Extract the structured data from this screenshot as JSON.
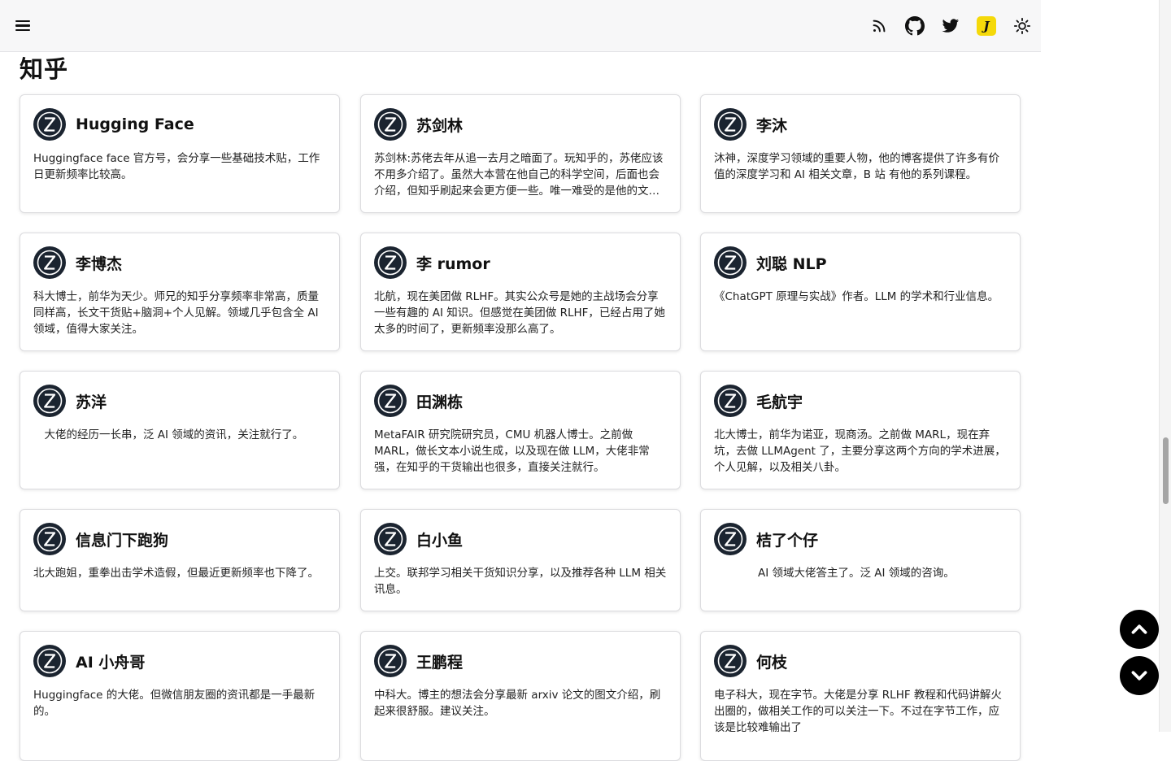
{
  "header": {
    "menu_icon": "hamburger-menu-icon",
    "icons": [
      "rss-icon",
      "github-icon",
      "twitter-icon",
      "j-badge-icon",
      "sun-icon"
    ],
    "j_badge_text": "J"
  },
  "section": {
    "title": "知乎"
  },
  "cards": [
    {
      "name": "Hugging Face",
      "desc": "Huggingface face 官方号，会分享一些基础技术贴，工作日更新频率比较高。"
    },
    {
      "name": "苏剑林",
      "desc": "苏剑林:苏佬去年从追一去月之暗面了。玩知乎的，苏佬应该不用多介绍了。虽然大本营在他自己的科学空间，后面也会介绍，但知乎刷起来会更方便一些。唯一难受的是他的文章公式太多了，知乎上看可能会比较吃力。"
    },
    {
      "name": "李沐",
      "desc": "沐神，深度学习领域的重要人物，他的博客提供了许多有价值的深度学习和 AI 相关文章，B 站 有他的系列课程。"
    },
    {
      "name": "李博杰",
      "desc": "科大博士，前华为天少。师兄的知乎分享频率非常高，质量同样高，长文干货贴+脑洞+个人见解。领域几乎包含全 AI 领域，值得大家关注。"
    },
    {
      "name": "李 rumor",
      "desc": "北航，现在美团做 RLHF。其实公众号是她的主战场会分享一些有趣的 AI 知识。但感觉在美团做 RLHF，已经占用了她太多的时间了，更新频率没那么高了。"
    },
    {
      "name": "刘聪 NLP",
      "desc": "《ChatGPT 原理与实战》作者。LLM 的学术和行业信息。"
    },
    {
      "name": "苏洋",
      "desc": "　大佬的经历一长串，泛 AI 领域的资讯，关注就行了。"
    },
    {
      "name": "田渊栋",
      "desc": "MetaFAIR 研究院研究员，CMU 机器人博士。之前做 MARL，做长文本小说生成，以及现在做 LLM，大佬非常强，在知乎的干货输出也很多，直接关注就行。"
    },
    {
      "name": "毛航宇",
      "desc": "北大博士，前华为诺亚，现商汤。之前做 MARL，现在弃坑，去做 LLMAgent 了，主要分享这两个方向的学术进展，个人见解，以及相关八卦。"
    },
    {
      "name": "信息门下跑狗",
      "desc": "北大跑姐，重拳出击学术造假，但最近更新频率也下降了。"
    },
    {
      "name": "白小鱼",
      "desc": "上交。联邦学习相关干货知识分享，以及推荐各种 LLM 相关讯息。"
    },
    {
      "name": "桔了个仔",
      "desc": "　　　　AI 领域大佬答主了。泛 AI 领域的咨询。"
    },
    {
      "name": "AI 小舟哥",
      "desc": "Huggingface 的大佬。但微信朋友圈的资讯都是一手最新的。"
    },
    {
      "name": "王鹏程",
      "desc": "中科大。博主的想法会分享最新 arxiv 论文的图文介绍，刷起来很舒服。建议关注。"
    },
    {
      "name": "何枝",
      "desc": "电子科大，现在字节。大佬是分享 RLHF 教程和代码讲解火出圈的，做相关工作的可以关注一下。不过在字节工作，应该是比较难输出了"
    }
  ],
  "fabs": {
    "up_icon": "chevron-up-icon",
    "down_icon": "chevron-down-icon"
  }
}
